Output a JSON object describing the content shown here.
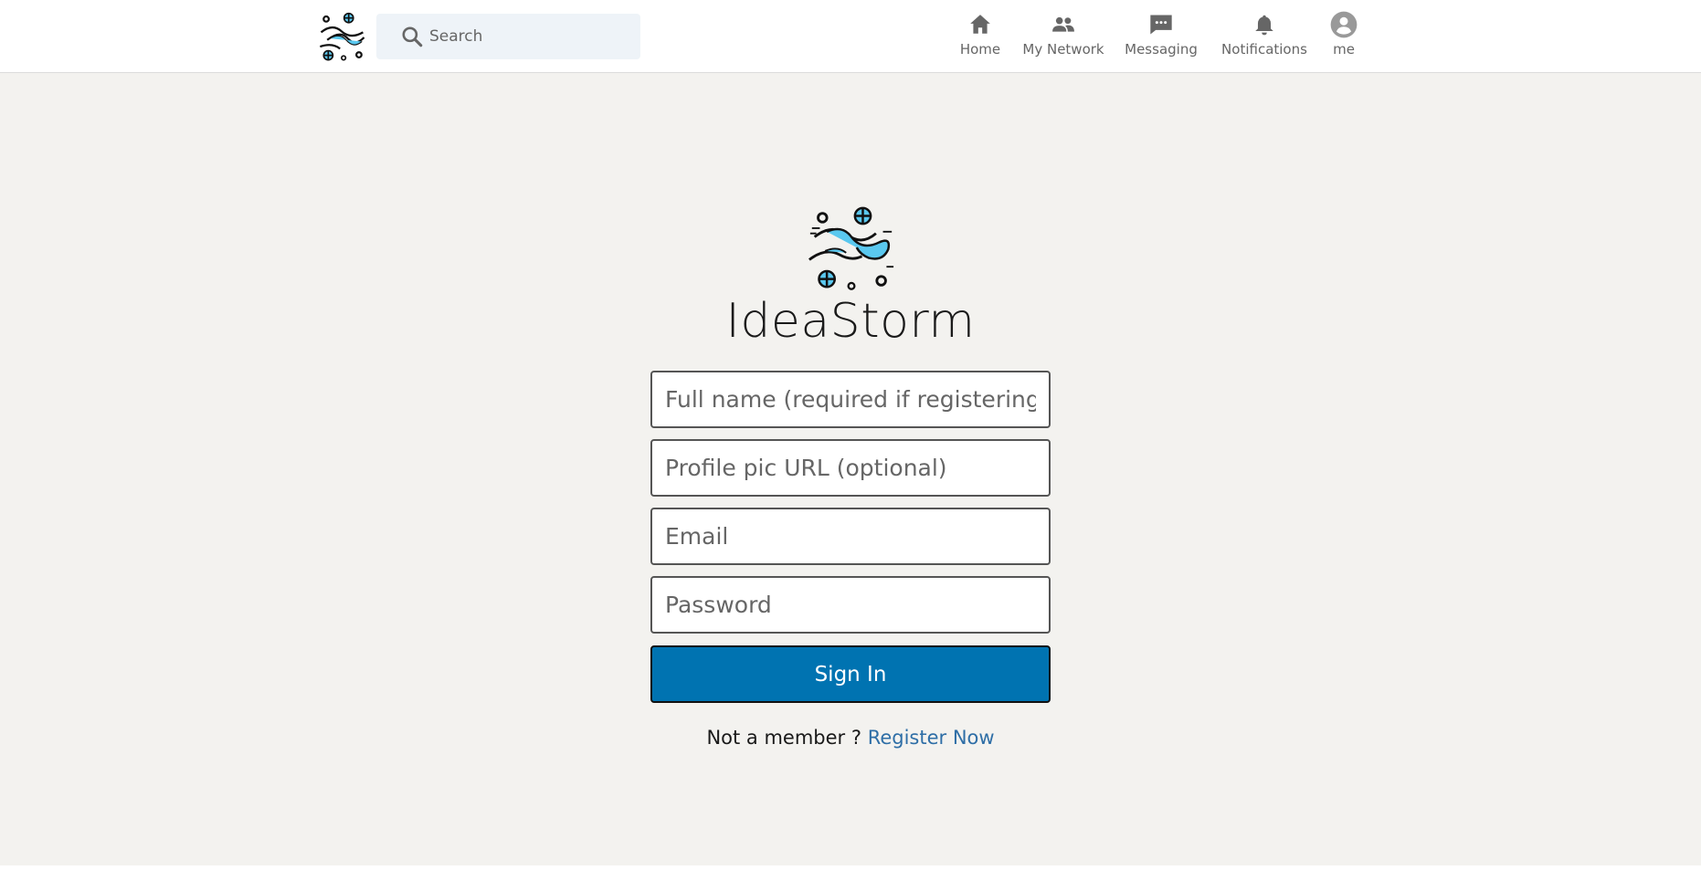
{
  "header": {
    "logo_icon": "storm-logo-icon",
    "search": {
      "placeholder": "Search",
      "icon": "search-icon"
    },
    "nav": [
      {
        "label": "Home",
        "icon": "home-icon"
      },
      {
        "label": "My Network",
        "icon": "network-icon"
      },
      {
        "label": "Messaging",
        "icon": "messaging-icon"
      },
      {
        "label": "Notifications",
        "icon": "bell-icon"
      },
      {
        "label": "me",
        "icon": "account-icon"
      }
    ]
  },
  "auth": {
    "brand_title": "IdeaStorm",
    "fields": {
      "full_name_placeholder": "Full name (required if registering)",
      "profile_pic_placeholder": "Profile pic URL (optional)",
      "email_placeholder": "Email",
      "password_placeholder": "Password"
    },
    "sign_in_label": "Sign In",
    "register_prompt": "Not a member ?",
    "register_link": "Register Now"
  },
  "colors": {
    "primary": "#0073b1",
    "link": "#2e6ea6",
    "background": "#f3f2ef",
    "search_bg": "#eef3f8",
    "logo_accent": "#5ac8ef"
  }
}
